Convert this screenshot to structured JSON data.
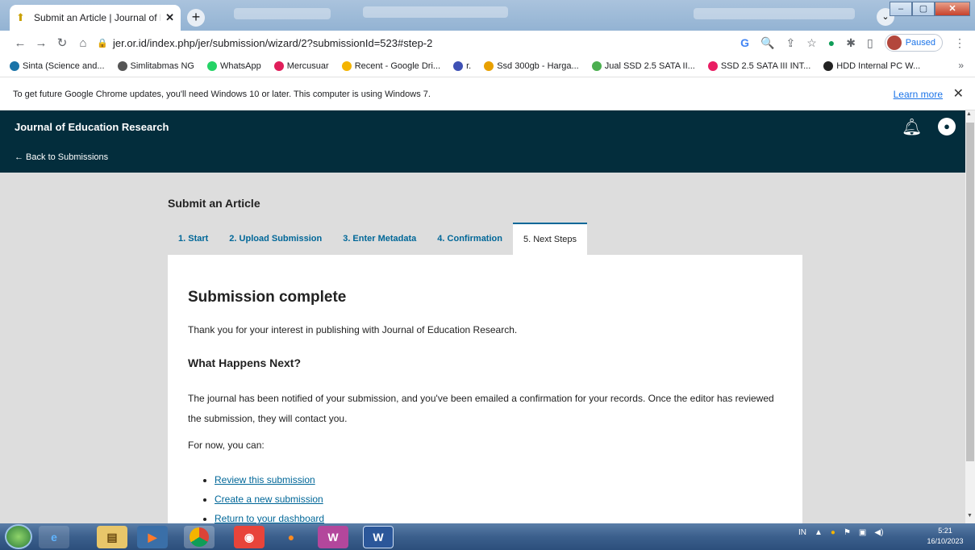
{
  "browser": {
    "tab_title": "Submit an Article | Journal of Edu",
    "url": "jer.or.id/index.php/jer/submission/wizard/2?submissionId=523#step-2",
    "profile_status": "Paused",
    "bookmarks": [
      {
        "label": "Sinta (Science and...",
        "icon_color": "#1a73a8"
      },
      {
        "label": "Simlitabmas NG",
        "icon_color": "#555555"
      },
      {
        "label": "WhatsApp",
        "icon_color": "#25d366"
      },
      {
        "label": "Mercusuar",
        "icon_color": "#e01e5a"
      },
      {
        "label": "Recent - Google Dri...",
        "icon_color": "#f4b400"
      },
      {
        "label": "r.",
        "icon_color": "#3f51b5"
      },
      {
        "label": "Ssd 300gb - Harga...",
        "icon_color": "#e8a000"
      },
      {
        "label": "Jual SSD 2.5 SATA II...",
        "icon_color": "#4caf50"
      },
      {
        "label": "SSD 2.5 SATA III INT...",
        "icon_color": "#e91e63"
      },
      {
        "label": "HDD Internal PC W...",
        "icon_color": "#222222"
      }
    ],
    "bookmarks_more": "»",
    "infobar_text": "To get future Google Chrome updates, you'll need Windows 10 or later. This computer is using Windows 7.",
    "infobar_link": "Learn more"
  },
  "site": {
    "title": "Journal of Education Research",
    "back_link": "← Back to Submissions",
    "header_color": "#032d3c",
    "accent": "#006798"
  },
  "page": {
    "title": "Submit an Article",
    "steps": [
      {
        "label": "1. Start",
        "active": false
      },
      {
        "label": "2. Upload Submission",
        "active": false
      },
      {
        "label": "3. Enter Metadata",
        "active": false
      },
      {
        "label": "4. Confirmation",
        "active": false
      },
      {
        "label": "5. Next Steps",
        "active": true
      }
    ],
    "heading": "Submission complete",
    "thanks": "Thank you for your interest in publishing with Journal of Education Research.",
    "subheading": "What Happens Next?",
    "paragraph": "The journal has been notified of your submission, and you've been emailed a confirmation for your records. Once the editor has reviewed the submission, they will contact you.",
    "for_now": "For now, you can:",
    "links": [
      "Review this submission",
      "Create a new submission",
      "Return to your dashboard"
    ]
  },
  "taskbar": {
    "language": "IN",
    "time": "5:21",
    "date": "16/10/2023"
  }
}
